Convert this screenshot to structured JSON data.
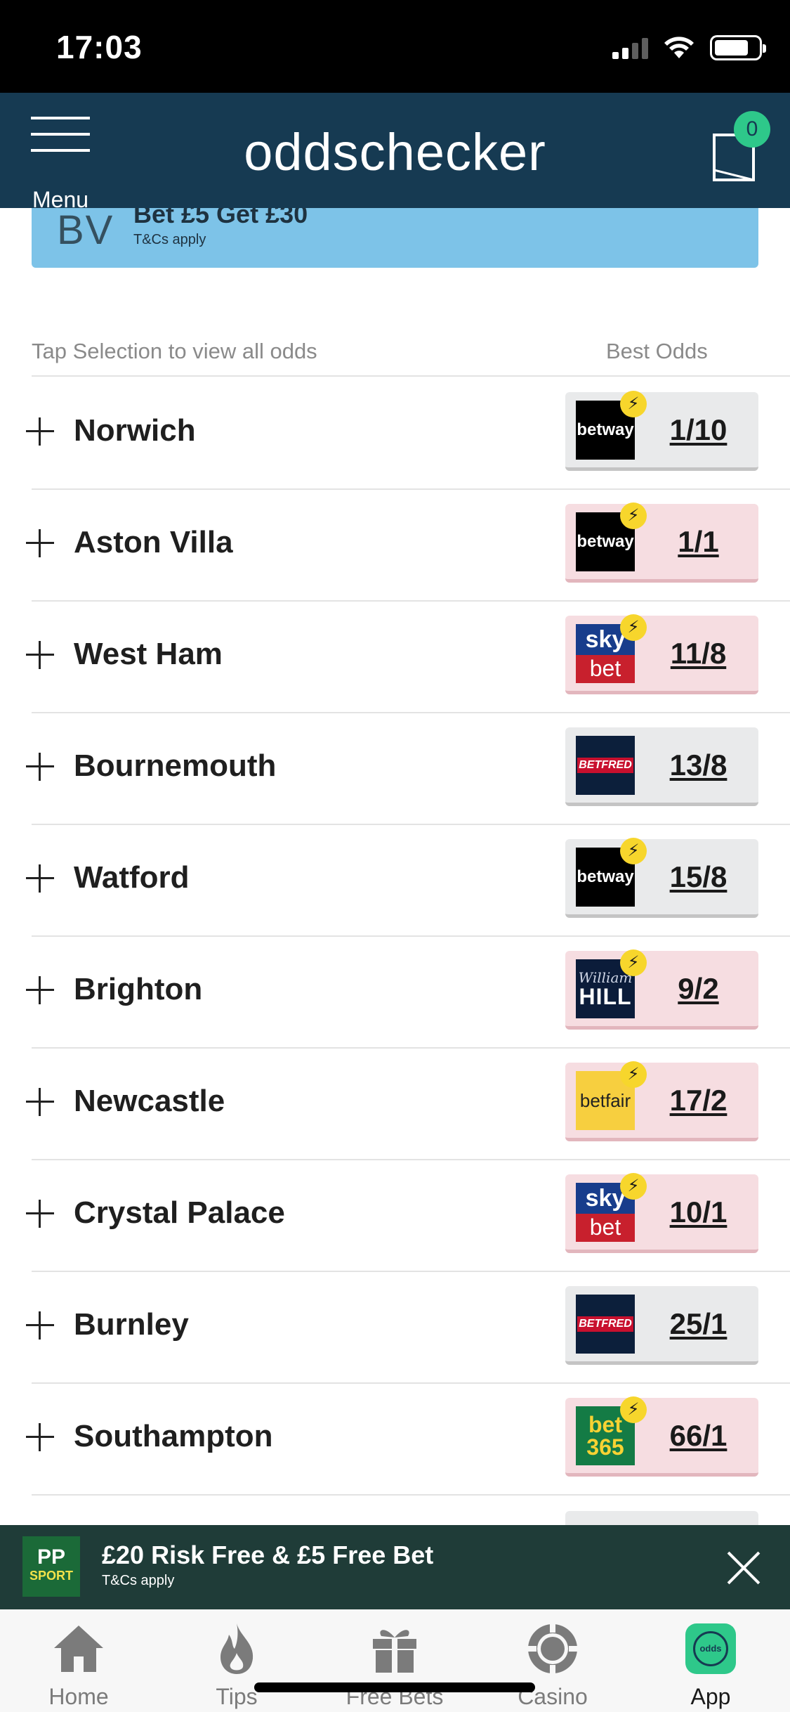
{
  "status_bar": {
    "time": "17:03"
  },
  "header": {
    "menu_label": "Menu",
    "brand": "oddschecker",
    "betslip_count": "0"
  },
  "promo": {
    "logo": "BV",
    "title": "Bet £5 Get £30",
    "tcs": "T&Cs apply"
  },
  "list": {
    "hint": "Tap Selection to view all odds",
    "best_odds_label": "Best Odds",
    "rows": [
      {
        "name": "Norwich",
        "bookmaker": "betway",
        "odds": "1/10",
        "boost": true,
        "highlight": "grey"
      },
      {
        "name": "Aston Villa",
        "bookmaker": "betway",
        "odds": "1/1",
        "boost": true,
        "highlight": "pink"
      },
      {
        "name": "West Ham",
        "bookmaker": "sky bet",
        "odds": "11/8",
        "boost": true,
        "highlight": "pink"
      },
      {
        "name": "Bournemouth",
        "bookmaker": "BETFRED",
        "odds": "13/8",
        "boost": false,
        "highlight": "grey"
      },
      {
        "name": "Watford",
        "bookmaker": "betway",
        "odds": "15/8",
        "boost": true,
        "highlight": "grey"
      },
      {
        "name": "Brighton",
        "bookmaker": "William HILL",
        "odds": "9/2",
        "boost": true,
        "highlight": "pink"
      },
      {
        "name": "Newcastle",
        "bookmaker": "betfair",
        "odds": "17/2",
        "boost": true,
        "highlight": "pink"
      },
      {
        "name": "Crystal Palace",
        "bookmaker": "sky bet",
        "odds": "10/1",
        "boost": true,
        "highlight": "pink"
      },
      {
        "name": "Burnley",
        "bookmaker": "BETFRED",
        "odds": "25/1",
        "boost": false,
        "highlight": "grey"
      },
      {
        "name": "Southampton",
        "bookmaker": "bet 365",
        "odds": "66/1",
        "boost": true,
        "highlight": "pink"
      }
    ]
  },
  "bookmaker_logos": {
    "betway": {
      "text": "betway"
    },
    "skybet": {
      "top": "sky",
      "bottom": "bet"
    },
    "betfred": {
      "text": "BETFRED"
    },
    "williamhill": {
      "script": "William",
      "main": "HILL"
    },
    "betfair": {
      "text": "betfair"
    },
    "bet365": {
      "top": "bet",
      "bottom": "365"
    }
  },
  "bottom_banner": {
    "logo_top": "PP",
    "logo_bottom": "SPORT",
    "title": "£20 Risk Free & £5 Free Bet",
    "tcs": "T&Cs apply"
  },
  "tabbar": {
    "tabs": [
      {
        "label": "Home",
        "icon": "home-icon"
      },
      {
        "label": "Tips",
        "icon": "flame-icon"
      },
      {
        "label": "Free Bets",
        "icon": "gift-icon"
      },
      {
        "label": "Casino",
        "icon": "casino-chip-icon"
      },
      {
        "label": "App",
        "icon": "app-icon",
        "icon_text": "odds"
      }
    ]
  },
  "colors": {
    "header_bg": "#163a52",
    "promo_bg": "#7dc3e8",
    "odds_pink": "#f6dde1",
    "odds_grey": "#e9eaeb",
    "accent_green": "#2ec88a",
    "banner_bg": "#1f3c38"
  }
}
